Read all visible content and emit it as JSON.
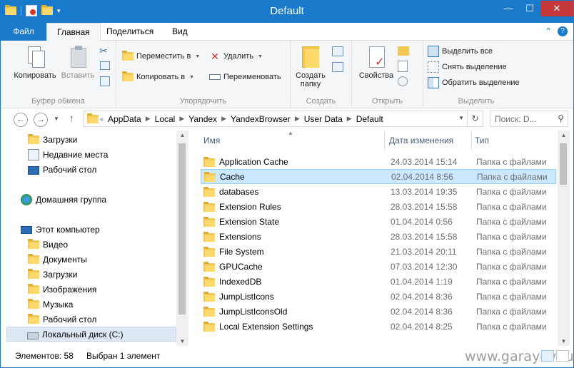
{
  "window": {
    "title": "Default"
  },
  "ribbon_tabs": {
    "file": "Файл",
    "home": "Главная",
    "share": "Поделиться",
    "view": "Вид"
  },
  "ribbon": {
    "clipboard": {
      "copy": "Копировать",
      "paste": "Вставить",
      "label": "Буфер обмена"
    },
    "organize": {
      "move_to": "Переместить в",
      "copy_to": "Копировать в",
      "delete": "Удалить",
      "rename": "Переименовать",
      "label": "Упорядочить"
    },
    "new": {
      "new_folder_line1": "Создать",
      "new_folder_line2": "папку",
      "label": "Создать"
    },
    "open": {
      "properties": "Свойства",
      "label": "Открыть"
    },
    "select": {
      "select_all": "Выделить все",
      "select_none": "Снять выделение",
      "invert": "Обратить выделение",
      "label": "Выделить"
    }
  },
  "address": {
    "prefix": "«",
    "crumbs": [
      "AppData",
      "Local",
      "Yandex",
      "YandexBrowser",
      "User Data",
      "Default"
    ],
    "search_placeholder": "Поиск: D..."
  },
  "nav_pane": {
    "items": [
      {
        "label": "Загрузки",
        "icon": "downloads-icon"
      },
      {
        "label": "Недавние места",
        "icon": "recent-places-icon"
      },
      {
        "label": "Рабочий стол",
        "icon": "desktop-icon"
      },
      {
        "label": "Домашняя группа",
        "icon": "homegroup-icon"
      },
      {
        "label": "Этот компьютер",
        "icon": "computer-icon"
      },
      {
        "label": "Видео",
        "icon": "video-folder-icon"
      },
      {
        "label": "Документы",
        "icon": "documents-folder-icon"
      },
      {
        "label": "Загрузки",
        "icon": "downloads-folder-icon"
      },
      {
        "label": "Изображения",
        "icon": "pictures-folder-icon"
      },
      {
        "label": "Музыка",
        "icon": "music-folder-icon"
      },
      {
        "label": "Рабочий стол",
        "icon": "desktop-folder-icon"
      },
      {
        "label": "Локальный диск (C:)",
        "icon": "drive-icon"
      }
    ]
  },
  "file_list": {
    "columns": {
      "name": "Имя",
      "date": "Дата изменения",
      "type": "Тип"
    },
    "rows": [
      {
        "name": "Application Cache",
        "date": "24.03.2014 15:14",
        "type": "Папка с файлами"
      },
      {
        "name": "Cache",
        "date": "02.04.2014 8:56",
        "type": "Папка с файлами"
      },
      {
        "name": "databases",
        "date": "13.03.2014 19:35",
        "type": "Папка с файлами"
      },
      {
        "name": "Extension Rules",
        "date": "28.03.2014 15:58",
        "type": "Папка с файлами"
      },
      {
        "name": "Extension State",
        "date": "01.04.2014 0:56",
        "type": "Папка с файлами"
      },
      {
        "name": "Extensions",
        "date": "28.03.2014 15:58",
        "type": "Папка с файлами"
      },
      {
        "name": "File System",
        "date": "21.03.2014 20:11",
        "type": "Папка с файлами"
      },
      {
        "name": "GPUCache",
        "date": "07.03.2014 12:30",
        "type": "Папка с файлами"
      },
      {
        "name": "IndexedDB",
        "date": "01.04.2014 1:19",
        "type": "Папка с файлами"
      },
      {
        "name": "JumpListIcons",
        "date": "02.04.2014 8:36",
        "type": "Папка с файлами"
      },
      {
        "name": "JumpListIconsOld",
        "date": "02.04.2014 8:36",
        "type": "Папка с файлами"
      },
      {
        "name": "Local Extension Settings",
        "date": "02.04.2014 8:25",
        "type": "Папка с файлами"
      }
    ]
  },
  "status": {
    "elements": "Элементов: 58",
    "selected": "Выбран 1 элемент",
    "watermark": "www.garayev.ru"
  },
  "colors": {
    "accent": "#1979ca",
    "selection": "#cce8ff",
    "folder": "#f3c954"
  }
}
